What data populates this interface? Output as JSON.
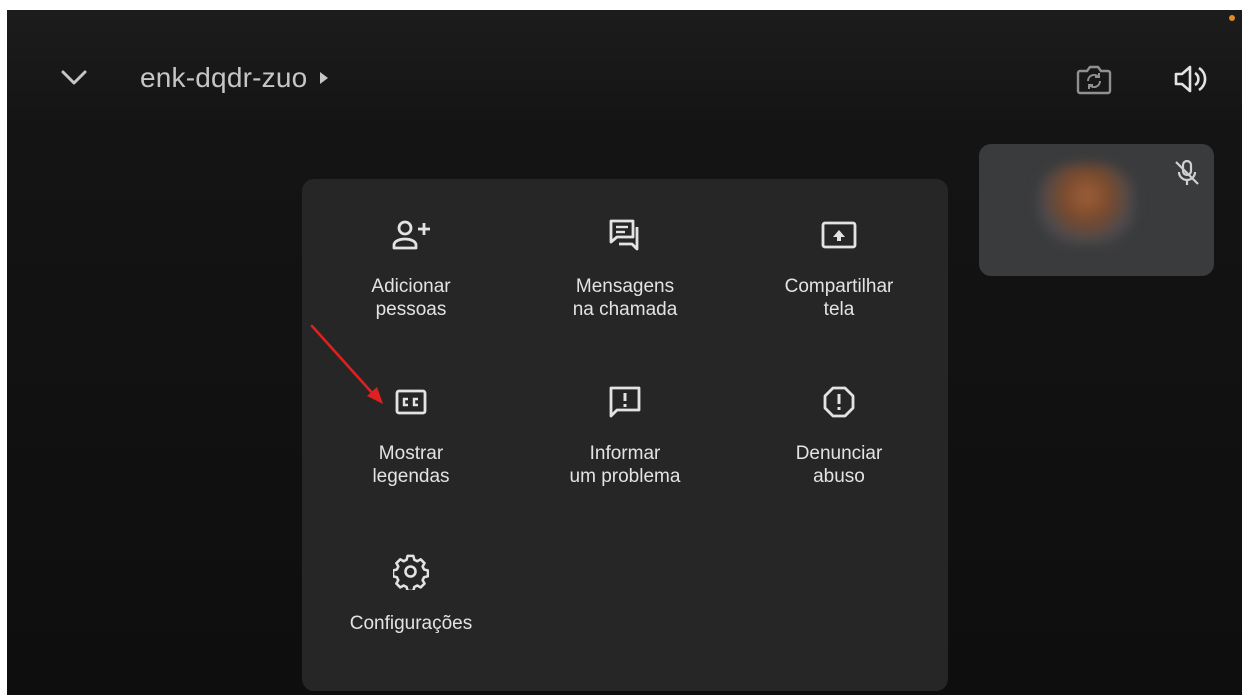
{
  "topbar": {
    "back_icon": "chevron-down-icon",
    "meeting_code": "enk-dqdr-zuo",
    "meeting_code_icon": "caret-right-icon",
    "camera_switch_icon": "switch-camera-icon",
    "speaker_icon": "speaker-icon"
  },
  "self_view": {
    "mic_status_icon": "mic-off-icon"
  },
  "menu": {
    "items": [
      {
        "label": "Adicionar\npessoas",
        "icon": "add-person-icon"
      },
      {
        "label": "Mensagens\nna chamada",
        "icon": "chat-icon"
      },
      {
        "label": "Compartilhar\ntela",
        "icon": "share-screen-icon"
      },
      {
        "label": "Mostrar\nlegendas",
        "icon": "closed-captions-icon"
      },
      {
        "label": "Informar\num problema",
        "icon": "feedback-icon"
      },
      {
        "label": "Denunciar\nabuso",
        "icon": "report-icon"
      },
      {
        "label": "Configurações",
        "icon": "gear-icon"
      }
    ]
  },
  "colors": {
    "background": "#141414",
    "panel": "#262626",
    "text": "#e3e3e3",
    "code_text": "#c4c7c5",
    "annotation_arrow": "#e02020"
  }
}
